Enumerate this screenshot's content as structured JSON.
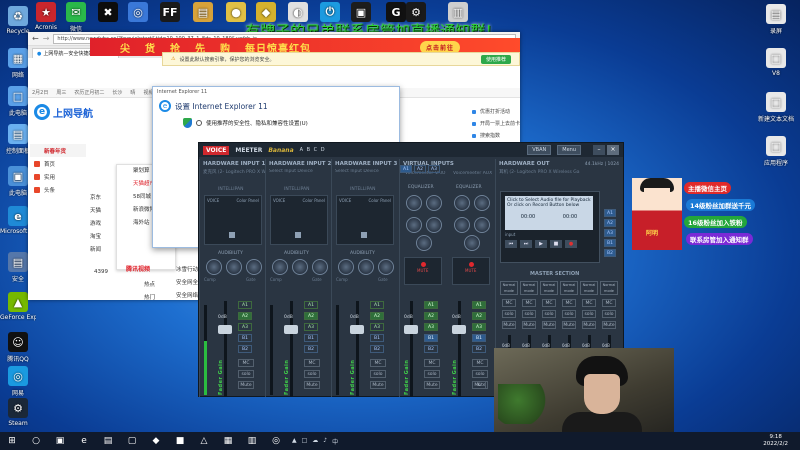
{
  "banner": {
    "text": "有牌子的兄弟联系房管加直播通知群！"
  },
  "desktop_top_icons": [
    {
      "label": "Acronis",
      "glyph": "★",
      "color": "#c9262d"
    },
    {
      "label": "微信",
      "glyph": "✉",
      "color": "#2ab84a"
    },
    {
      "label": "",
      "glyph": "✖",
      "color": "#0d0d0d"
    },
    {
      "label": "",
      "glyph": "◎",
      "color": "#3a78d8"
    },
    {
      "label": "",
      "glyph": "FF",
      "color": "#1a1a1a"
    },
    {
      "label": "",
      "glyph": "▤",
      "color": "#d6a23a"
    },
    {
      "label": "",
      "glyph": "●",
      "color": "#e0c045"
    },
    {
      "label": "",
      "glyph": "◆",
      "color": "#d4b12e"
    },
    {
      "label": "",
      "glyph": "◐",
      "color": "#e0e0e0"
    },
    {
      "label": "",
      "glyph": "⏻",
      "color": "#1c9ae0"
    },
    {
      "label": "",
      "glyph": "▣",
      "color": "#1d1d1d"
    },
    {
      "label": "",
      "glyph": "G",
      "color": "#111"
    },
    {
      "label": "",
      "glyph": "⚙",
      "color": "#1a1a1a"
    },
    {
      "label": "",
      "glyph": "▥",
      "color": "#cfcfcf"
    }
  ],
  "desktop_left_icons": [
    {
      "label": "Recycle",
      "glyph": "♻",
      "color": "#6fa8dc"
    },
    {
      "label": "网络",
      "glyph": "▦",
      "color": "#5aa0e8"
    },
    {
      "label": "此电脑",
      "glyph": "□",
      "color": "#5aa0e8"
    },
    {
      "label": "控制面板",
      "glyph": "▤",
      "color": "#6ab0f0"
    },
    {
      "label": "此电脑",
      "glyph": "▣",
      "color": "#4a90d8"
    },
    {
      "label": "Microsoft Edge",
      "glyph": "e",
      "color": "#1f8ad6"
    },
    {
      "label": "安全",
      "glyph": "▤",
      "color": "#5577aa"
    },
    {
      "label": "GeForce Experience",
      "glyph": "▲",
      "color": "#76b900"
    },
    {
      "label": "腾讯QQ",
      "glyph": "☺",
      "color": "#111"
    },
    {
      "label": "网易",
      "glyph": "◎",
      "color": "#1a9ae0"
    },
    {
      "label": "Steam",
      "glyph": "⚙",
      "color": "#1b2838"
    }
  ],
  "desktop_right_icons": [
    {
      "label": "录屏",
      "glyph": "▤",
      "color": "#e8e8e8"
    },
    {
      "label": "V8",
      "glyph": "□",
      "color": "#e8e8e8"
    },
    {
      "label": "新建文本文档",
      "glyph": "□",
      "color": "#e8e8e8"
    },
    {
      "label": "应用程序",
      "glyph": "□",
      "color": "#e8e8e8"
    }
  ],
  "browser": {
    "url": "http://www.newduba.cn/?f=quickstart&tid=10_100_37_1_8ds_10_180&u=fdr_ie",
    "tab": "上网导航—安全快捷的网址...",
    "promo": [
      "尖",
      "货",
      "抢",
      "先",
      "购",
      "每日惊喜红包"
    ],
    "promo_btn": "点击前往",
    "nav": [
      "2月2日",
      "周三",
      "农历正月初二",
      "长沙",
      "晴",
      "视频",
      "购物"
    ],
    "logo": "上网导航",
    "cats": [
      "首页",
      "实用",
      "头条",
      "京东",
      "天猫",
      "携程",
      "去哪儿",
      "天猫"
    ],
    "cat_header": "新春年货",
    "left_sites": [
      "京东",
      "天猫",
      "游戏",
      "淘宝",
      "新闻"
    ],
    "popover": [
      "聚划算",
      "天猫超市",
      "58同城",
      "新浪微博",
      "海外站"
    ],
    "hot_title": "腾讯视频",
    "hot_list": [
      "热点",
      "热门"
    ],
    "mid_list": [
      "冰雪行动元优",
      "安全网全面",
      "安全网络安全"
    ],
    "right_links": [
      "优惠打折活动",
      "开局一票上去前卡",
      "搜索指数"
    ],
    "next_btn": "下一",
    "numbers": [
      "4399",
      "热点"
    ]
  },
  "notice": {
    "text": "设置此默认搜索引擎，保护您的浏览安全。",
    "ok": "使用推荐"
  },
  "dialog": {
    "titlebar": "Internet Explorer 11",
    "title": "设置 Internet Explorer 11",
    "option": "使用推荐的安全性、隐私和兼容性设置(U)"
  },
  "voicemeeter": {
    "logo": "VOICE",
    "logo2": "MEETER",
    "brand": "Banana",
    "badge": "A B C D",
    "vban": "VBAN",
    "menu": "Menu",
    "hw_inputs": [
      {
        "title": "HARDWARE INPUT 1",
        "sub": "麦克风 (2- Logitech PRO X Wire",
        "name": "INTELLIPAN",
        "voice": "VOICE",
        "cp": "Color Panel"
      },
      {
        "title": "HARDWARE INPUT 2",
        "sub": "Select Input Device",
        "name": "INTELLIPAN",
        "voice": "VOICE",
        "cp": "Color Panel"
      },
      {
        "title": "HARDWARE INPUT 3",
        "sub": "Select Input Device",
        "name": "INTELLIPAN",
        "voice": "VOICE",
        "cp": "Color Panel"
      }
    ],
    "virtual": {
      "title": "VIRTUAL INPUTS",
      "v1": "Voicemeeter VAIO",
      "v2": "Voicemeeter AUX",
      "eq": "EQUALIZER",
      "mute": "MUTE"
    },
    "hw_out": {
      "title": "HARDWARE OUT",
      "sub": "耳机 (2- Logitech PRO X Wireless Ga",
      "rate": "44.1kHz | 1024",
      "a1": "A1",
      "a2": "A2",
      "a3": "A3"
    },
    "tape": {
      "line1": "Click to Select Audio file for Playback",
      "line2": "Or click on Record Button below",
      "time1": "00:00",
      "time2": "00:00",
      "input": "input"
    },
    "labels": {
      "comp": "Comp",
      "audibility": "AUDIBILITY",
      "gate": "Gate",
      "fader": "Fader Gain",
      "mono": "MC",
      "solo": "solo",
      "mute": "Mute",
      "zero": "0dB",
      "master": "MASTER SECTION",
      "normal": "Normal mode",
      "k": "K"
    },
    "bus_buttons": [
      "A1",
      "A2",
      "A3",
      "B1",
      "B2"
    ],
    "master_cols": 6
  },
  "stream": {
    "tags": [
      {
        "text": "主播微信主页",
        "bg": "#e02a2a",
        "color": "#fff"
      },
      {
        "text": "14级粉丝加群送千元",
        "bg": "#1a7ad6",
        "color": "#fff"
      },
      {
        "text": "16级粉丝加入铁粉",
        "bg": "#23a63b",
        "color": "#fff"
      },
      {
        "text": "联系房管加入通知群",
        "bg": "#7a2ad6",
        "color": "#fff"
      }
    ],
    "avatar_text": "阿明"
  },
  "taskbar": {
    "icons": [
      "⊞",
      "○",
      "▣",
      "e",
      "▤",
      "▢",
      "◆",
      "■",
      "△",
      "▦",
      "▥",
      "◎"
    ],
    "time": "9:18",
    "date": "2022/2/2",
    "tray": [
      "▲",
      "□",
      "☁",
      "♪",
      "中"
    ]
  }
}
